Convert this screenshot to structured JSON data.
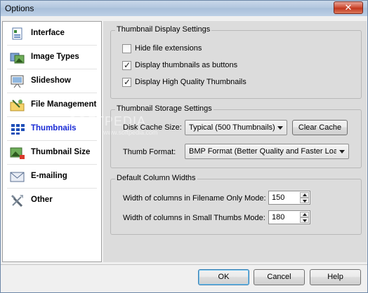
{
  "window": {
    "title": "Options",
    "close_glyph": "✕"
  },
  "sidebar": {
    "items": [
      {
        "label": "Interface",
        "icon": "interface-icon"
      },
      {
        "label": "Image Types",
        "icon": "image-types-icon"
      },
      {
        "label": "Slideshow",
        "icon": "slideshow-icon"
      },
      {
        "label": "File Management",
        "icon": "file-management-icon"
      },
      {
        "label": "Thumbnails",
        "icon": "thumbnails-icon",
        "selected": true
      },
      {
        "label": "Thumbnail Size",
        "icon": "thumbnail-size-icon"
      },
      {
        "label": "E-mailing",
        "icon": "emailing-icon"
      },
      {
        "label": "Other",
        "icon": "other-icon"
      }
    ]
  },
  "display": {
    "title": "Thumbnail Display Settings",
    "hide_ext": {
      "label": "Hide file extensions",
      "checked": false
    },
    "as_buttons": {
      "label": "Display thumbnails as buttons",
      "checked": true
    },
    "hq": {
      "label": "Display High Quality Thumbnails",
      "checked": true
    }
  },
  "storage": {
    "title": "Thumbnail Storage Settings",
    "cache_label": "Disk Cache Size:",
    "cache_value": "Typical (500 Thumbnails)",
    "clear_button": "Clear Cache",
    "format_label": "Thumb Format:",
    "format_value": "BMP Format (Better Quality and Faster Loadi"
  },
  "columns": {
    "title": "Default Column Widths",
    "filename_label": "Width of columns in Filename Only Mode:",
    "filename_value": "150",
    "small_label": "Width of columns in Small Thumbs Mode:",
    "small_value": "180"
  },
  "buttons": {
    "ok": "OK",
    "cancel": "Cancel",
    "help": "Help"
  },
  "watermark": {
    "text": "SOFTPEDIA",
    "sub": "www.softpedia.com"
  },
  "check_glyph": "✓"
}
